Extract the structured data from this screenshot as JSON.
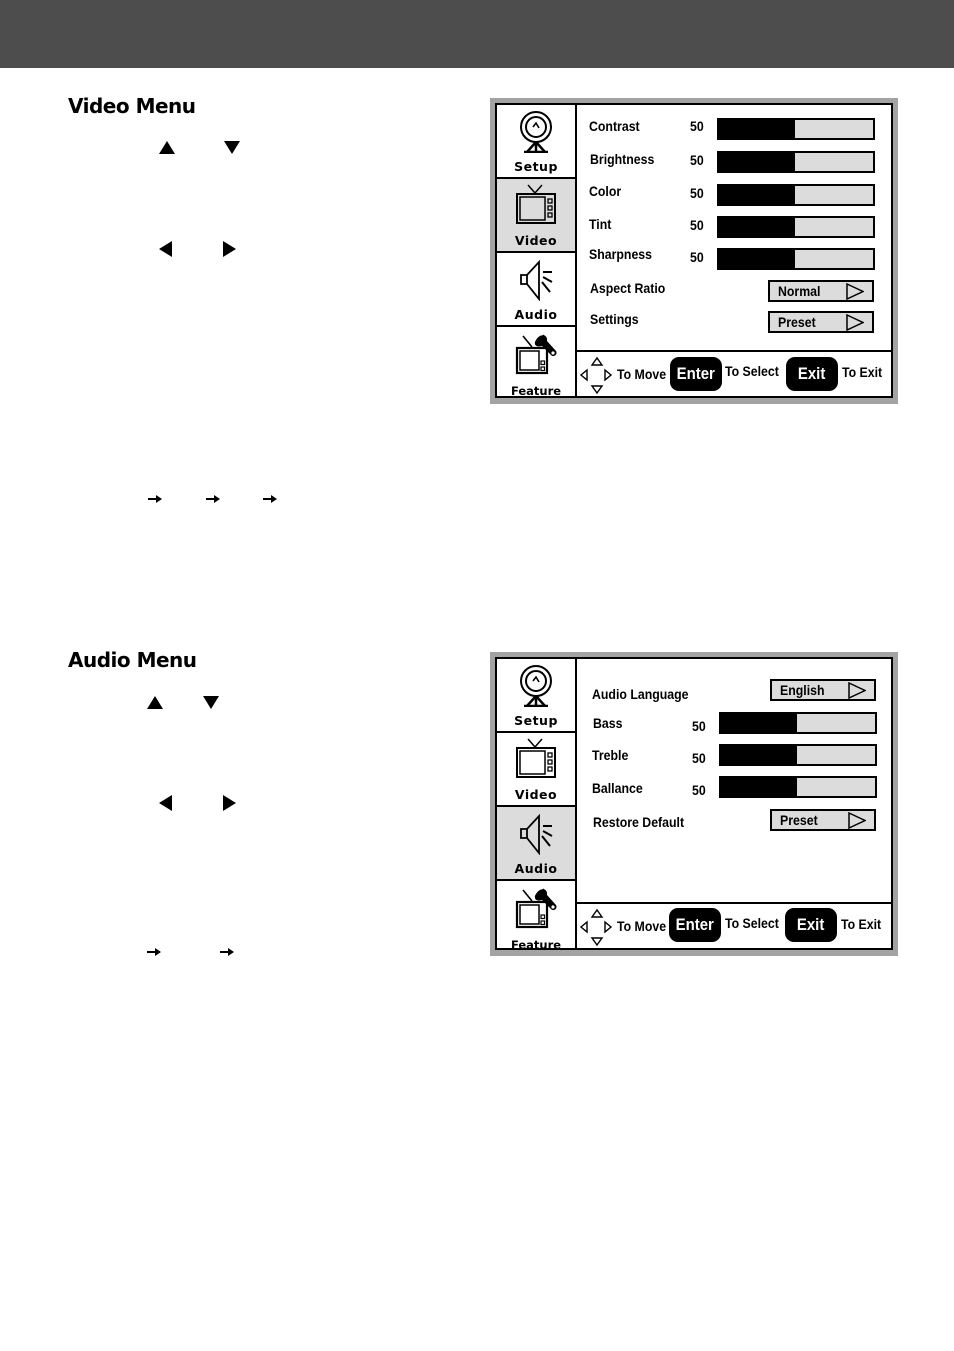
{
  "video_section": {
    "title": "Video Menu",
    "nav_glyphs": [
      "up-triangle",
      "down-triangle",
      "left-triangle",
      "right-triangle"
    ],
    "flow_arrows": 3
  },
  "audio_section": {
    "title": "Audio Menu",
    "nav_glyphs": [
      "up-triangle",
      "down-triangle",
      "left-triangle",
      "right-triangle"
    ],
    "flow_arrows": 2
  },
  "sidebar": {
    "items": [
      {
        "label": "Setup",
        "icon": "satellite-dish-icon"
      },
      {
        "label": "Video",
        "icon": "tv-icon"
      },
      {
        "label": "Audio",
        "icon": "speaker-icon"
      },
      {
        "label": "Feature",
        "icon": "tv-wrench-icon"
      }
    ]
  },
  "video_menu": {
    "active_tab": "Video",
    "sliders": [
      {
        "label": "Contrast",
        "value": "50",
        "percent": 50
      },
      {
        "label": "Brightness",
        "value": "50",
        "percent": 50
      },
      {
        "label": "Color",
        "value": "50",
        "percent": 50
      },
      {
        "label": "Tint",
        "value": "50",
        "percent": 50
      },
      {
        "label": "Sharpness",
        "value": "50",
        "percent": 50
      }
    ],
    "selects": [
      {
        "label": "Aspect Ratio",
        "value": "Normal"
      },
      {
        "label": "Settings",
        "value": "Preset"
      }
    ]
  },
  "audio_menu": {
    "active_tab": "Audio",
    "language": {
      "label": "Audio Language",
      "value": "English"
    },
    "sliders": [
      {
        "label": "Bass",
        "value": "50",
        "percent": 50
      },
      {
        "label": "Treble",
        "value": "50",
        "percent": 50
      },
      {
        "label": "Ballance",
        "value": "50",
        "percent": 50
      }
    ],
    "restore": {
      "label": "Restore Default",
      "value": "Preset"
    }
  },
  "footer": {
    "move_text": "To Move",
    "enter_key": "Enter",
    "select_text": "To Select",
    "exit_key": "Exit",
    "exit_text": "To Exit"
  },
  "colors": {
    "header_band": "#4d4d4d",
    "frame": "#a3a3a3",
    "active_tab": "#dcdcdc",
    "bar_track": "#dcdcdc",
    "bar_fill": "#000000"
  }
}
